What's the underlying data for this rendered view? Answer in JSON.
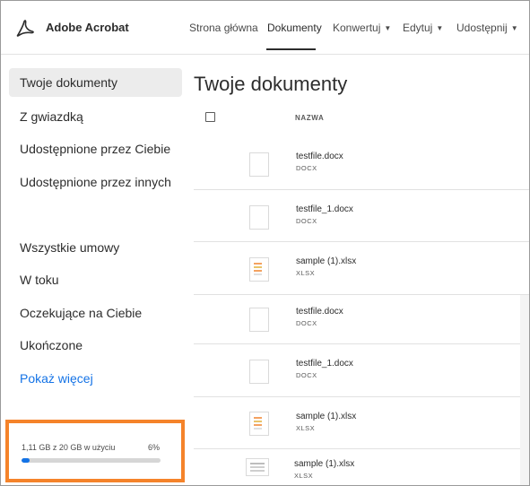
{
  "app": {
    "title": "Adobe Acrobat",
    "logo_icon": "acrobat-logo-icon",
    "brand_color": "#2c2c2c"
  },
  "nav": {
    "items": [
      {
        "label": "Strona główna",
        "has_dropdown": false
      },
      {
        "label": "Dokumenty",
        "has_dropdown": false,
        "active": true
      },
      {
        "label": "Konwertuj",
        "has_dropdown": true
      },
      {
        "label": "Edytuj",
        "has_dropdown": true
      },
      {
        "label": "Udostępnij",
        "has_dropdown": true
      }
    ]
  },
  "sidebar": {
    "items": [
      {
        "label": "Twoje dokumenty",
        "active": true
      },
      {
        "label": "Z gwiazdką"
      },
      {
        "label": "Udostępnione przez Ciebie"
      },
      {
        "label": "Udostępnione przez innych"
      },
      {
        "label": "Wszystkie umowy"
      },
      {
        "label": "W toku"
      },
      {
        "label": "Oczekujące na Ciebie"
      },
      {
        "label": "Ukończone"
      }
    ],
    "show_more": "Pokaż więcej",
    "link_color": "#1473e6"
  },
  "storage": {
    "usage_text": "1,11 GB z 20 GB w użyciu",
    "percent_text": "6%",
    "percent_value": 6,
    "highlight_color": "#f5832a",
    "bar_color": "#1473e6"
  },
  "main": {
    "title": "Twoje dokumenty",
    "column_name": "NAZWA",
    "files": [
      {
        "name": "testfile.docx",
        "type": "DOCX",
        "thumb": "docx"
      },
      {
        "name": "testfile_1.docx",
        "type": "DOCX",
        "thumb": "docx"
      },
      {
        "name": "sample (1).xlsx",
        "type": "XLSX",
        "thumb": "xlsx"
      },
      {
        "name": "testfile.docx",
        "type": "DOCX",
        "thumb": "docx"
      },
      {
        "name": "testfile_1.docx",
        "type": "DOCX",
        "thumb": "docx"
      },
      {
        "name": "sample (1).xlsx",
        "type": "XLSX",
        "thumb": "xlsx"
      },
      {
        "name": "sample (1).xlsx",
        "type": "XLSX",
        "thumb": "wide"
      }
    ]
  }
}
